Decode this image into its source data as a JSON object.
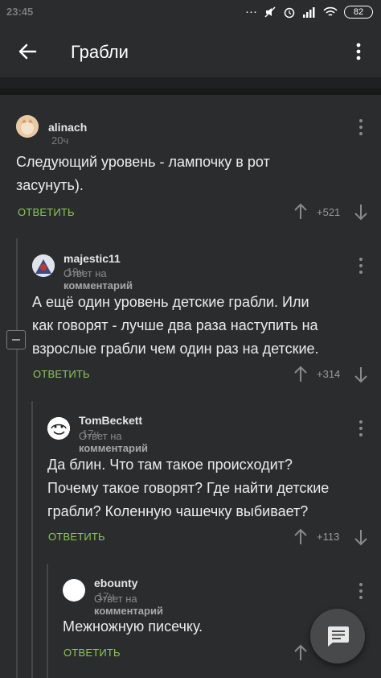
{
  "status": {
    "time": "23:45",
    "battery": "82"
  },
  "toolbar": {
    "title": "Грабли"
  },
  "comments": [
    {
      "author": "alinach",
      "time": "20ч",
      "body_lines": [
        "Следующий уровень - лампочку в рот",
        "засунуть)."
      ],
      "reply": "ОТВЕТИТЬ",
      "score": "+521"
    },
    {
      "author": "majestic11",
      "time": "19ч",
      "reply_to_prefix": "Ответ на",
      "reply_to_target": "комментарий",
      "body_lines": [
        "А ещё один уровень детские грабли. Или",
        "как говорят - лучше два раза наступить на",
        "взрослые грабли чем один раз на детские."
      ],
      "reply": "ОТВЕТИТЬ",
      "score": "+314"
    },
    {
      "author": "TomBeckett",
      "time": "17ч",
      "reply_to_prefix": "Ответ на",
      "reply_to_target": "комментарий",
      "body_lines": [
        "Да блин. Что там такое происходит?",
        "Почему такое говорят? Где найти детские",
        "грабли? Коленную чашечку выбивает?"
      ],
      "reply": "ОТВЕТИТЬ",
      "score": "+113"
    },
    {
      "author": "ebounty",
      "time": "17ч",
      "reply_to_prefix": "Ответ на",
      "reply_to_target": "комментарий",
      "body_lines": [
        "Межножную писечку."
      ],
      "reply": "ОТВЕТИТЬ",
      "score": ""
    }
  ],
  "colors": {
    "accent": "#8ac858",
    "background": "#2b2c2e"
  },
  "icons": {
    "back": "arrow-left-icon",
    "more": "more-vertical-icon",
    "fab": "message-icon"
  }
}
